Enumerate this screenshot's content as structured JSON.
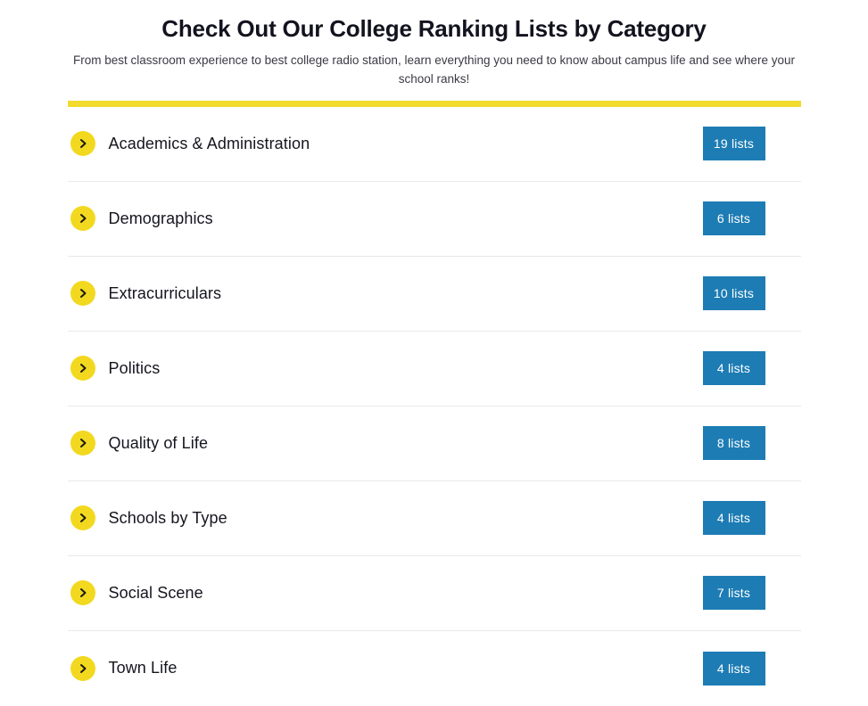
{
  "header": {
    "title": "Check Out Our College Ranking Lists by Category",
    "subtitle": "From best classroom experience to best college radio station, learn everything you need to know about campus life and see where your school ranks!",
    "accent_color": "#f2db2c"
  },
  "theme": {
    "accent_yellow": "#f2db2c",
    "chevron_circle": "#f2d91f",
    "badge_blue": "#1d7cb4",
    "text_dark": "#15151f",
    "divider": "#e9e9ec"
  },
  "categories": [
    {
      "label": "Academics & Administration",
      "count_label": "19 lists",
      "count": 19,
      "icon": "chevron-right-icon"
    },
    {
      "label": "Demographics",
      "count_label": "6 lists",
      "count": 6,
      "icon": "chevron-right-icon"
    },
    {
      "label": "Extracurriculars",
      "count_label": "10 lists",
      "count": 10,
      "icon": "chevron-right-icon"
    },
    {
      "label": "Politics",
      "count_label": "4 lists",
      "count": 4,
      "icon": "chevron-right-icon"
    },
    {
      "label": "Quality of Life",
      "count_label": "8 lists",
      "count": 8,
      "icon": "chevron-right-icon"
    },
    {
      "label": "Schools by Type",
      "count_label": "4 lists",
      "count": 4,
      "icon": "chevron-right-icon"
    },
    {
      "label": "Social Scene",
      "count_label": "7 lists",
      "count": 7,
      "icon": "chevron-right-icon"
    },
    {
      "label": "Town Life",
      "count_label": "4 lists",
      "count": 4,
      "icon": "chevron-right-icon"
    }
  ]
}
